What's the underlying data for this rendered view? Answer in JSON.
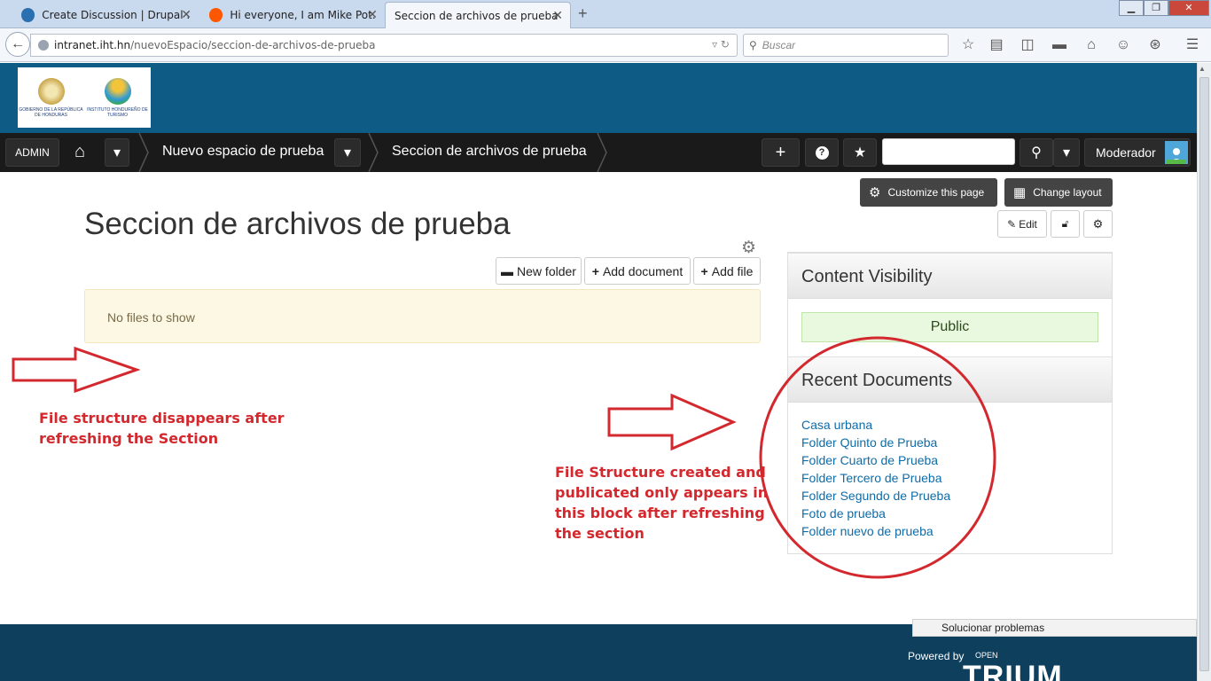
{
  "browser": {
    "tabs": [
      {
        "title": "Create Discussion | Drupal ...",
        "favicon": "drupal-icon",
        "color": "#2a6fb0"
      },
      {
        "title": "Hi everyone, I am Mike Pot...",
        "favicon": "reddit-icon",
        "color": "#ff5700"
      },
      {
        "title": "Seccion de archivos de prueba ...",
        "favicon": "page-icon",
        "color": "#ffffff"
      }
    ],
    "url_domain": "intranet.iht.hn",
    "url_path": "/nuevoEspacio/seccion-de-archivos-de-prueba",
    "search_placeholder": "Buscar"
  },
  "header": {
    "logo_left_text": "GOBIERNO DE LA REPÚBLICA DE HONDURAS",
    "logo_right_text": "INSTITUTO HONDUREÑO DE TURISMO"
  },
  "toolbar": {
    "admin_label": "ADMIN",
    "crumb_space": "Nuevo espacio de prueba",
    "crumb_section": "Seccion de archivos de prueba",
    "user_label": "Moderador"
  },
  "page": {
    "customize_label": "Customize this page",
    "change_layout_label": "Change layout",
    "edit_label": "Edit",
    "title": "Seccion de archivos de prueba",
    "new_folder_label": "New folder",
    "add_document_label": "Add document",
    "add_file_label": "Add file",
    "empty_message": "No files to show"
  },
  "sidebar": {
    "visibility_title": "Content Visibility",
    "visibility_value": "Public",
    "recent_title": "Recent Documents",
    "recent_docs": [
      "Casa urbana",
      "Folder Quinto de Prueba",
      "Folder Cuarto de Prueba",
      "Folder Tercero de Prueba",
      "Folder Segundo de Prueba",
      "Foto de prueba",
      "Folder nuevo de prueba"
    ]
  },
  "annotations": {
    "left_line1": "File structure disappears after",
    "left_line2": "refreshing the Section",
    "right_line1": "File Structure created and",
    "right_line2": "publicated only appears in",
    "right_line3": "this block after refreshing",
    "right_line4": "the section",
    "color": "#d3282d"
  },
  "footer": {
    "powered_by": "Powered by",
    "brand_top": "OPEN",
    "brand_main": "TRIUM",
    "troubleshoot": "Solucionar problemas"
  }
}
